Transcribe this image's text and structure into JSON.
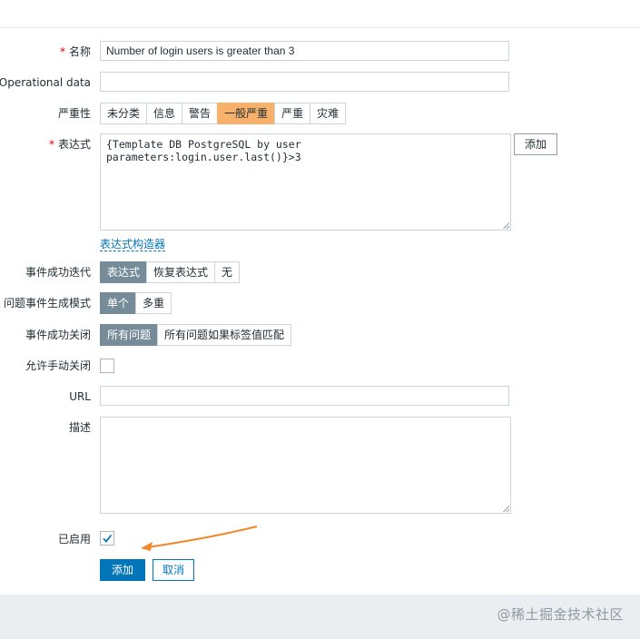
{
  "form": {
    "name": {
      "label": "名称",
      "required_mark": "*",
      "value": "Number of login users is greater than 3"
    },
    "opdata": {
      "label": "Operational data",
      "value": ""
    },
    "severity": {
      "label": "严重性",
      "options": [
        "未分类",
        "信息",
        "警告",
        "一般严重",
        "严重",
        "灾难"
      ],
      "selected": "一般严重"
    },
    "expression": {
      "label": "表达式",
      "required_mark": "*",
      "value": "{Template DB PostgreSQL by user\nparameters:login.user.last()}>3",
      "add_label": "添加",
      "builder_link": "表达式构造器"
    },
    "ok_event_generation": {
      "label": "事件成功迭代",
      "options": [
        "表达式",
        "恢复表达式",
        "无"
      ],
      "selected": "表达式"
    },
    "problem_event_mode": {
      "label": "问题事件生成模式",
      "options": [
        "单个",
        "多重"
      ],
      "selected": "单个"
    },
    "ok_event_closes": {
      "label": "事件成功关闭",
      "options": [
        "所有问题",
        "所有问题如果标签值匹配"
      ],
      "selected": "所有问题"
    },
    "allow_manual_close": {
      "label": "允许手动关闭",
      "checked": false
    },
    "url": {
      "label": "URL",
      "value": ""
    },
    "description": {
      "label": "描述",
      "value": ""
    },
    "enabled": {
      "label": "已启用",
      "checked": true
    },
    "buttons": {
      "add": "添加",
      "cancel": "取消"
    }
  },
  "watermark": "@稀土掘金技术社区",
  "colors": {
    "primary": "#0275b8",
    "selected_gray": "#768d99",
    "severity_average": "#f7b16b",
    "arrow": "#f0892b"
  }
}
